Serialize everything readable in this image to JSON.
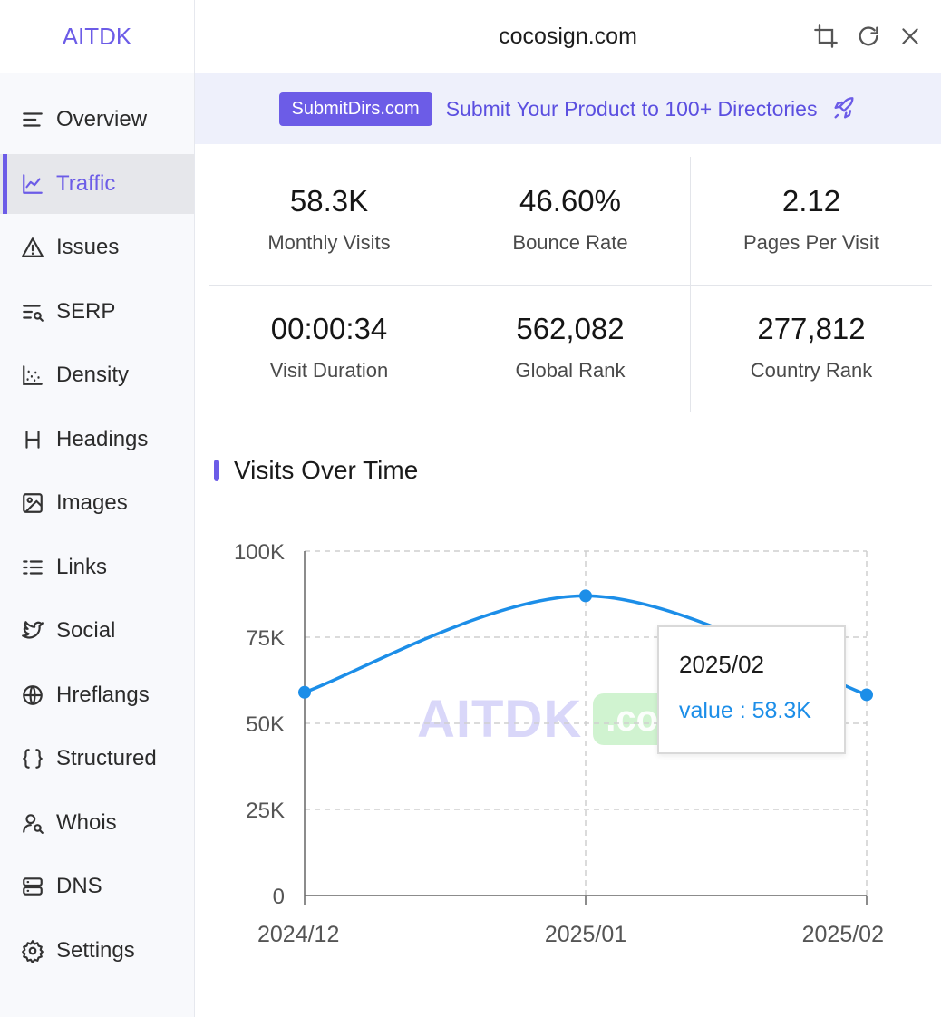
{
  "sidebar": {
    "brand": "AITDK",
    "items": [
      {
        "label": "Overview",
        "icon": "overview-icon"
      },
      {
        "label": "Traffic",
        "icon": "traffic-icon",
        "active": true
      },
      {
        "label": "Issues",
        "icon": "warning-icon"
      },
      {
        "label": "SERP",
        "icon": "serp-icon"
      },
      {
        "label": "Density",
        "icon": "density-icon"
      },
      {
        "label": "Headings",
        "icon": "heading-icon"
      },
      {
        "label": "Images",
        "icon": "image-icon"
      },
      {
        "label": "Links",
        "icon": "links-icon"
      },
      {
        "label": "Social",
        "icon": "twitter-icon"
      },
      {
        "label": "Hreflangs",
        "icon": "globe-icon"
      },
      {
        "label": "Structured",
        "icon": "braces-icon"
      },
      {
        "label": "Whois",
        "icon": "user-search-icon"
      },
      {
        "label": "DNS",
        "icon": "server-icon"
      },
      {
        "label": "Settings",
        "icon": "gear-icon"
      }
    ]
  },
  "header": {
    "title": "cocosign.com",
    "buttons": [
      "crop-icon",
      "refresh-icon",
      "close-icon"
    ]
  },
  "banner": {
    "pill": "SubmitDirs.com",
    "text": "Submit Your Product to 100+ Directories",
    "icon": "rocket-icon"
  },
  "stats": [
    {
      "value": "58.3K",
      "label": "Monthly Visits"
    },
    {
      "value": "46.60%",
      "label": "Bounce Rate"
    },
    {
      "value": "2.12",
      "label": "Pages Per Visit"
    },
    {
      "value": "00:00:34",
      "label": "Visit Duration"
    },
    {
      "value": "562,082",
      "label": "Global Rank"
    },
    {
      "value": "277,812",
      "label": "Country Rank"
    }
  ],
  "section": {
    "title": "Visits Over Time"
  },
  "watermark": {
    "text": "AITDK",
    "domain": ".com"
  },
  "tooltip": {
    "title": "2025/02",
    "value_text": "value : 58.3K"
  },
  "colors": {
    "accent": "#6c5ce7",
    "line": "#1c8ee8"
  },
  "chart_data": {
    "type": "line",
    "categories": [
      "2024/12",
      "2025/01",
      "2025/02"
    ],
    "series": [
      {
        "values": [
          59000,
          87000,
          58300
        ]
      }
    ],
    "ylim": [
      0,
      100000
    ],
    "yticks": [
      0,
      25000,
      50000,
      75000,
      100000
    ],
    "ytick_labels": [
      "0",
      "25K",
      "50K",
      "75K",
      "100K"
    ],
    "grid": true
  }
}
